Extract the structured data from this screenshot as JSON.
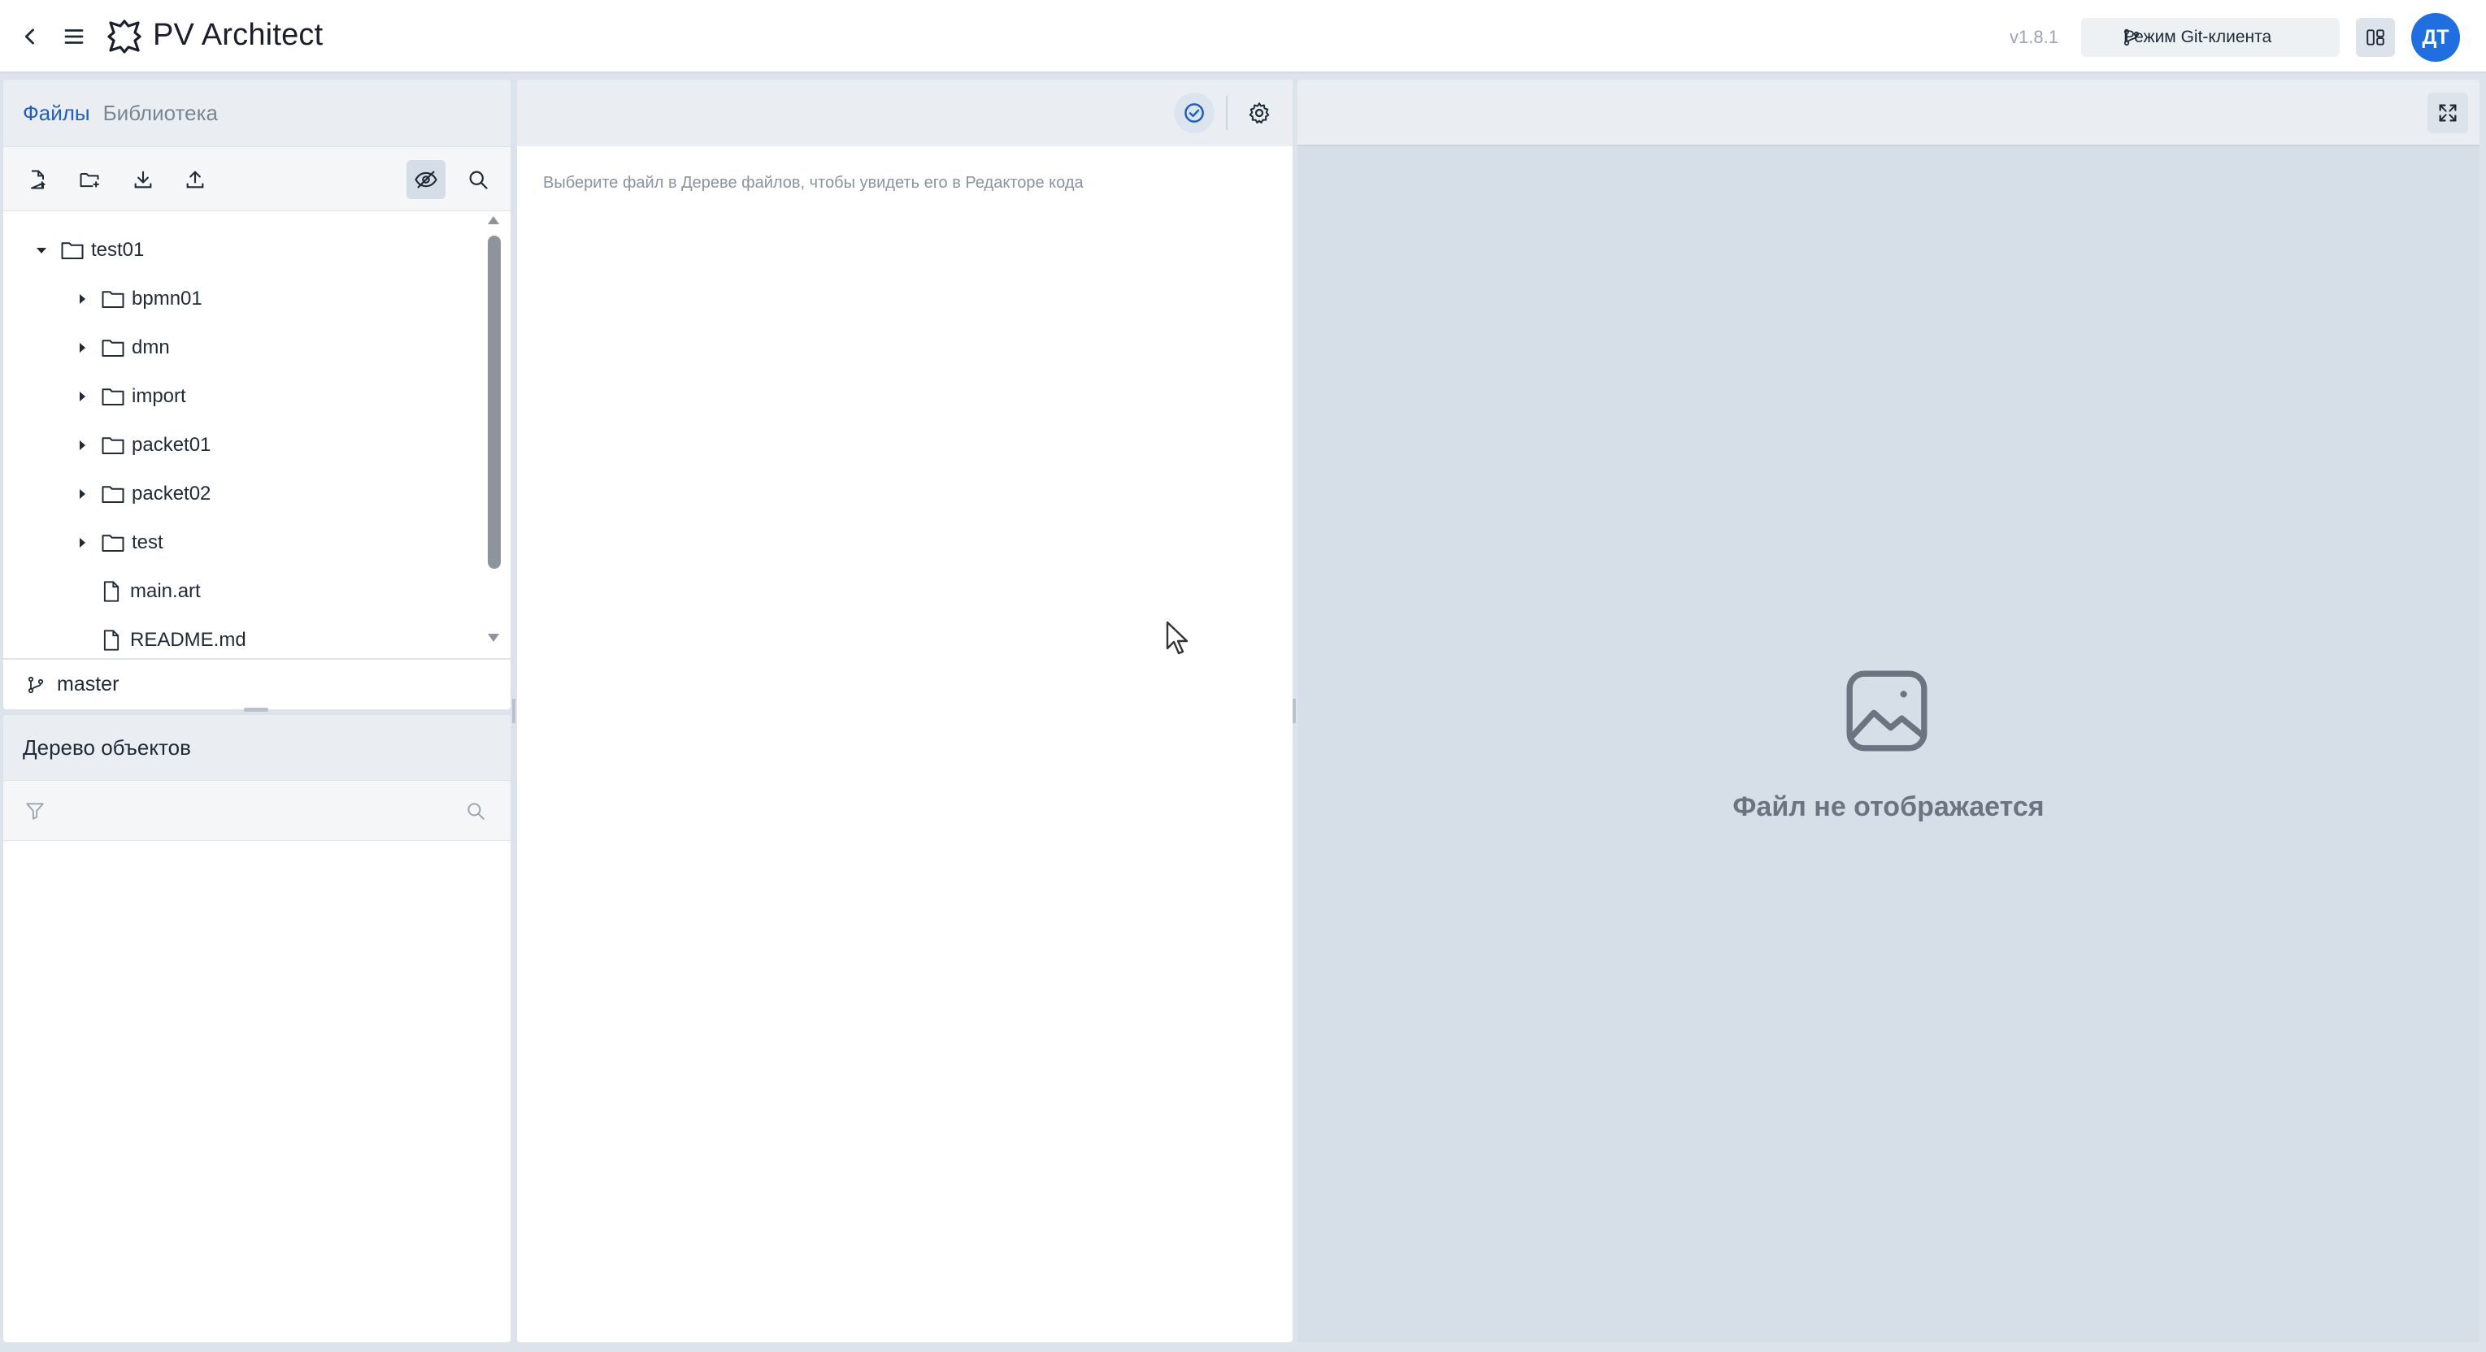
{
  "header": {
    "title": "PV Architect",
    "version": "v1.8.1",
    "git_mode_label": "Режим Git-клиента",
    "avatar_initials": "ДТ"
  },
  "left_panel": {
    "tabs": [
      {
        "label": "Файлы",
        "active": true
      },
      {
        "label": "Библиотека",
        "active": false
      }
    ],
    "file_tree": [
      {
        "label": "test01",
        "type": "folder",
        "expanded": true,
        "level": 0
      },
      {
        "label": "bpmn01",
        "type": "folder",
        "expanded": false,
        "level": 1
      },
      {
        "label": "dmn",
        "type": "folder",
        "expanded": false,
        "level": 1
      },
      {
        "label": "import",
        "type": "folder",
        "expanded": false,
        "level": 1
      },
      {
        "label": "packet01",
        "type": "folder",
        "expanded": false,
        "level": 1
      },
      {
        "label": "packet02",
        "type": "folder",
        "expanded": false,
        "level": 1
      },
      {
        "label": "test",
        "type": "folder",
        "expanded": false,
        "level": 1
      },
      {
        "label": "main.art",
        "type": "file",
        "level": 1
      },
      {
        "label": "README.md",
        "type": "file",
        "level": 1
      }
    ],
    "branch": "master"
  },
  "object_tree": {
    "title": "Дерево объектов",
    "filter_value": ""
  },
  "editor": {
    "hint": "Выберите файл в Дереве файлов, чтобы увидеть его в Редакторе кода"
  },
  "preview": {
    "placeholder": "Файл не отображается"
  },
  "colors": {
    "accent": "#1f6fe0",
    "active_tab": "#1f5fbf",
    "panel_header": "#eaeef2",
    "preview_bg": "#d6dfe7"
  }
}
